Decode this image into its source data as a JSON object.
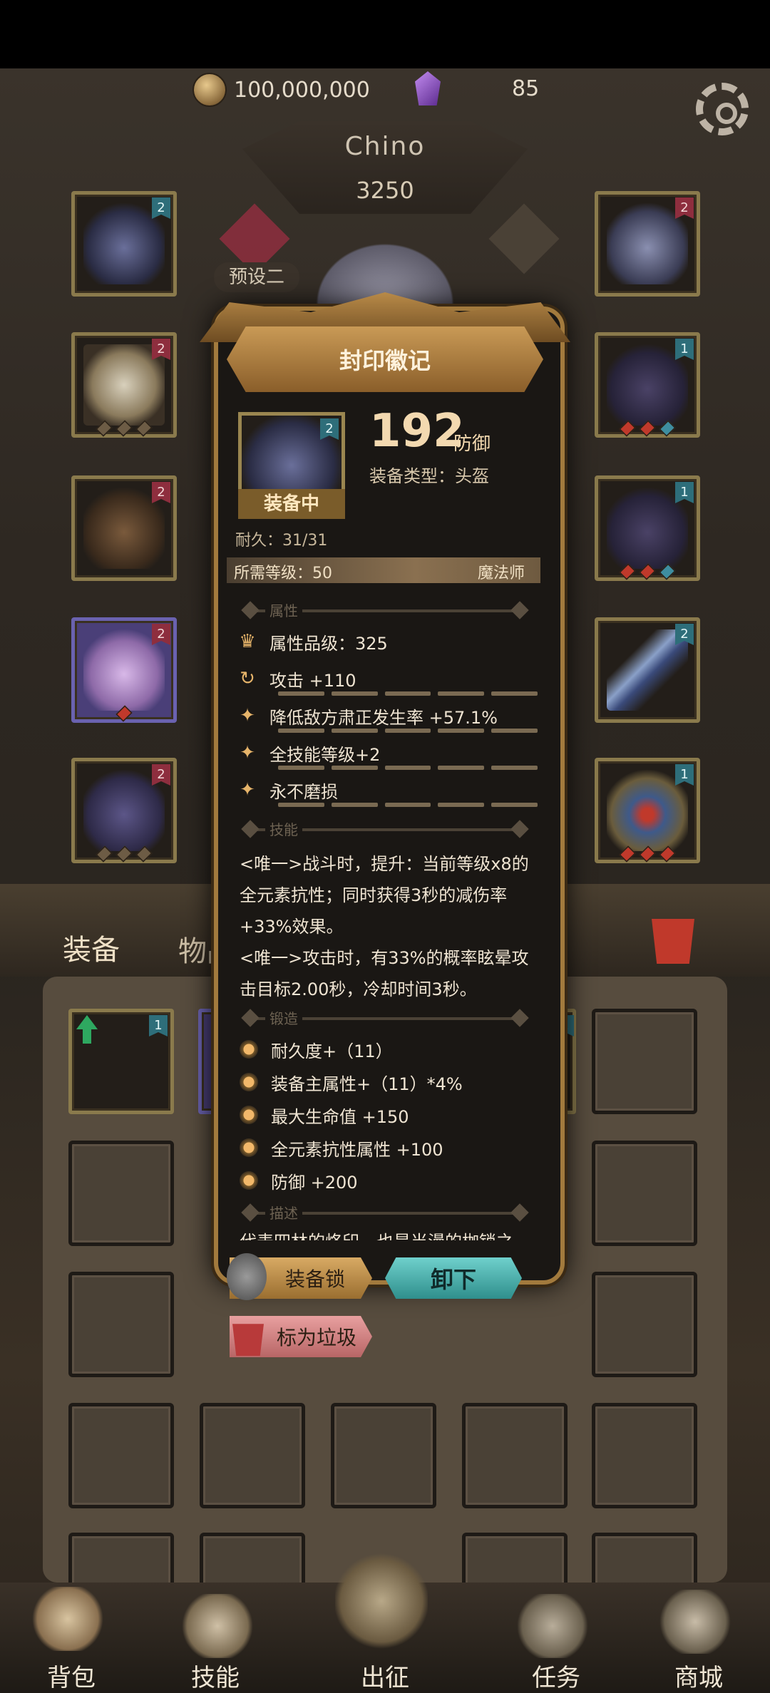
{
  "currency": {
    "gold": "100,000,000",
    "gems": "85"
  },
  "player": {
    "name": "Chino",
    "power": "3250"
  },
  "preset_label": "预设二",
  "tooltip": {
    "title": "封印徽记",
    "item_level_badge": "2",
    "equipped_label": "装备中",
    "defense_value": "192",
    "defense_label": "防御",
    "type_line": "装备类型：头盔",
    "durability": "耐久：31/31",
    "required_level": "所需等级：50",
    "class": "魔法师",
    "sections": {
      "attributes": "属性",
      "skills": "技能",
      "forge": "锻造",
      "description": "描述"
    },
    "attributes": [
      {
        "icon": "quality-crown-icon",
        "text": "属性品级：325"
      },
      {
        "icon": "swirl-icon",
        "text": "攻击 +110"
      },
      {
        "icon": "sparkle-icon",
        "text": "降低敌方肃正发生率 +57.1%"
      },
      {
        "icon": "sparkle-icon",
        "text": "全技能等级+2"
      },
      {
        "icon": "sparkle-icon",
        "text": "永不磨损"
      }
    ],
    "skill_lines": [
      "<唯一>战斗时，提升：当前等级x8的",
      "全元素抗性；同时获得3秒的减伤率",
      "+33%效果。",
      "<唯一>攻击时，有33%的概率眩晕攻",
      "击目标2.00秒，冷却时间3秒。"
    ],
    "forge": [
      "耐久度+（11）",
      "装备主属性+（11）*4%",
      "最大生命值 +150",
      "全元素抗性属性 +100",
      "防御 +200"
    ],
    "description_partial": "代表四林的烙印，也是当漫的枷锁之",
    "buttons": {
      "lock": "装备锁",
      "unequip": "卸下",
      "junk": "标为垃圾"
    }
  },
  "tabs": {
    "equipment": "装备",
    "items": "物品"
  },
  "nav": [
    "背包",
    "技能",
    "出征",
    "任务",
    "商城"
  ],
  "colors": {
    "gold_border": "#a27a3d",
    "unequip_button": "#4fb3b3",
    "junk_button": "#d98a8a",
    "lock_button": "#c99a56"
  }
}
